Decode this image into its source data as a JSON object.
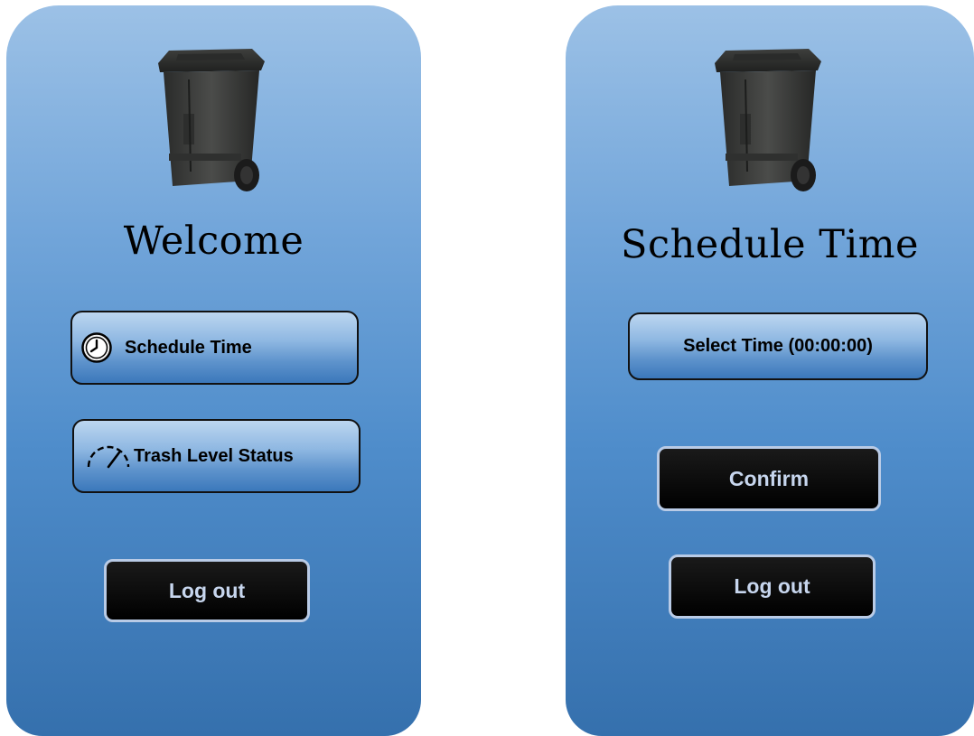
{
  "screens": [
    {
      "title": "Welcome",
      "buttons": {
        "schedule_time": "Schedule Time",
        "trash_level_status": "Trash Level Status",
        "log_out": "Log out"
      }
    },
    {
      "title": "Schedule Time",
      "buttons": {
        "select_time": "Select Time (00:00:00)",
        "confirm": "Confirm",
        "log_out": "Log out"
      }
    }
  ],
  "icons": {
    "bin": "trash-bin-icon",
    "clock": "clock-icon",
    "gauge": "gauge-icon"
  },
  "colors": {
    "panel_top": "#9cc1e6",
    "panel_bottom": "#3570ad",
    "dark_button_text": "#c7d6ee"
  }
}
